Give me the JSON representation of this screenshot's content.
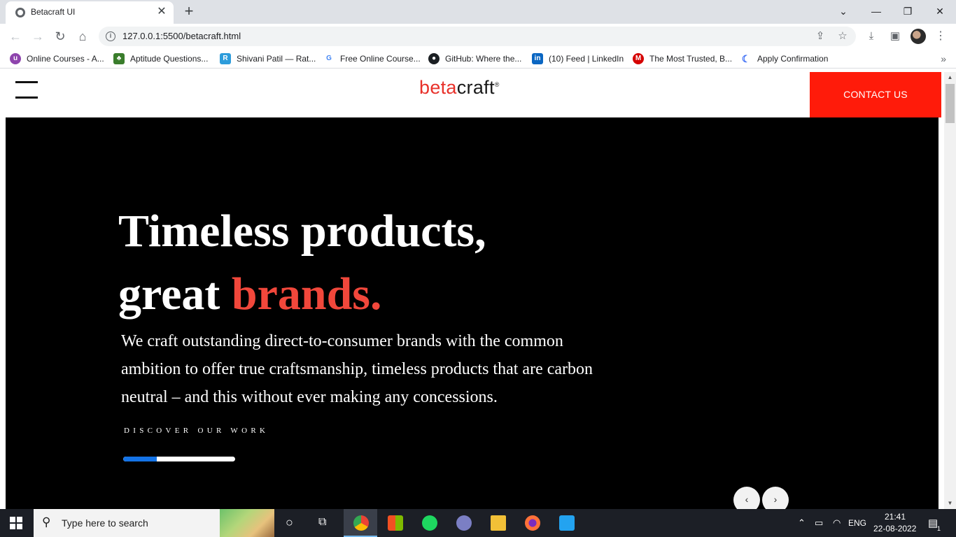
{
  "browser": {
    "tab_title": "Betacraft UI",
    "tab_close": "✕",
    "new_tab": "+",
    "window_controls": {
      "collapse": "⌄",
      "minimize": "—",
      "restore": "❐",
      "close": "✕"
    },
    "nav": {
      "back": "←",
      "forward": "→",
      "reload": "↻",
      "home": "⌂"
    },
    "url": "127.0.0.1:5500/betacraft.html",
    "info_icon": "i",
    "icons": [
      "share-icon",
      "star-icon",
      "download-icon",
      "side-panel-icon",
      "profile-avatar",
      "menu-icon"
    ],
    "glyphs": {
      "share": "⇪",
      "star": "☆",
      "download": "⤓",
      "sidepanel": "▣",
      "menu": "⋮",
      "more": "»"
    }
  },
  "bookmarks": [
    {
      "label": "Online Courses - A...",
      "icon": "u",
      "color": "#8e44ad"
    },
    {
      "label": "Aptitude Questions...",
      "icon": "♣",
      "color": "#3a7d2c"
    },
    {
      "label": "Shivani Patil — Rat...",
      "icon": "R",
      "color": "#2d9cdb"
    },
    {
      "label": "Free Online Course...",
      "icon": "G",
      "color": "#4285f4"
    },
    {
      "label": "GitHub: Where the...",
      "icon": "●",
      "color": "#1b1f23"
    },
    {
      "label": "(10) Feed | LinkedIn",
      "icon": "in",
      "color": "#0a66c2"
    },
    {
      "label": "The Most Trusted, B...",
      "icon": "M",
      "color": "#d50000"
    },
    {
      "label": "Apply Confirmation",
      "icon": "☾",
      "color": "#3d6ef5"
    }
  ],
  "site": {
    "logo_beta": "beta",
    "logo_craft": "craft",
    "logo_reg": "®",
    "contact": "CONTACT US",
    "headline_line1": "Timeless products,",
    "headline_line2_prefix": "great ",
    "headline_line2_accent": "brands.",
    "copy": "We craft outstanding direct-to-consumer brands with the common ambition to offer true craftsmanship, timeless products that are carbon neutral – and this without ever making any concessions.",
    "discover": "DISCOVER OUR WORK",
    "slider_progress": 0.3,
    "prev": "‹",
    "next": "›",
    "colors": {
      "accent": "#f1473b",
      "contact_bg": "#ff1b0a",
      "progress": "#1473e6"
    }
  },
  "taskbar": {
    "search_placeholder": "Type here to search",
    "search_glass": "⚲",
    "cortana": "○",
    "taskview": "⧉",
    "apps": [
      "chrome-icon",
      "store-icon",
      "spotify-icon",
      "arc-icon",
      "file-explorer-icon",
      "firefox-icon",
      "vscode-icon"
    ],
    "tray": {
      "chevron": "⌃",
      "battery": "▭",
      "wifi": "◠",
      "lang": "ENG",
      "time": "21:41",
      "date": "22-08-2022",
      "notify": "▤",
      "notify_count": "1"
    }
  }
}
